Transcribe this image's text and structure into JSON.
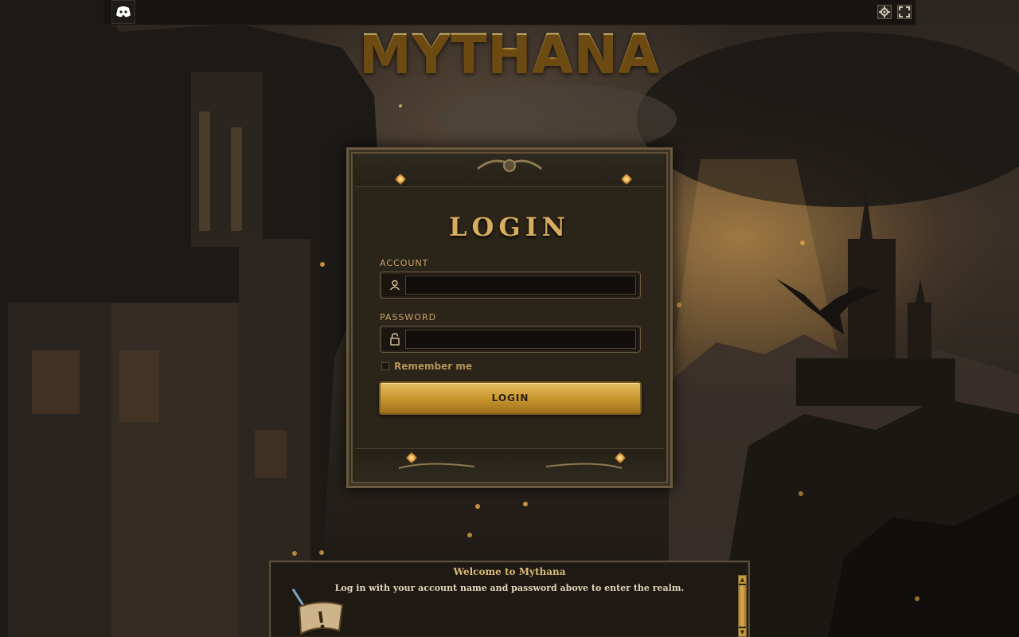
{
  "app": {
    "logo_text": "MYTHANA"
  },
  "topbar": {
    "discord_icon": "discord-icon",
    "settings_icon": "gear-icon",
    "fullscreen_icon": "fullscreen-icon"
  },
  "login_panel": {
    "title": "LOGIN",
    "account_label": "ACCOUNT",
    "account_value": "",
    "account_icon": "user-icon",
    "password_label": "PASSWORD",
    "password_value": "",
    "password_icon": "lock-icon",
    "remember_label": "Remember me",
    "remember_checked": false,
    "submit_label": "LOGIN"
  },
  "message_box": {
    "title": "Welcome to Mythana",
    "body": "Log in with your account name and password above to enter the realm.",
    "icon": "quill-scroll-icon"
  },
  "colors": {
    "accent_gold": "#d9a640",
    "panel_bg": "#2b2419",
    "button_gold": "#c9972f"
  }
}
